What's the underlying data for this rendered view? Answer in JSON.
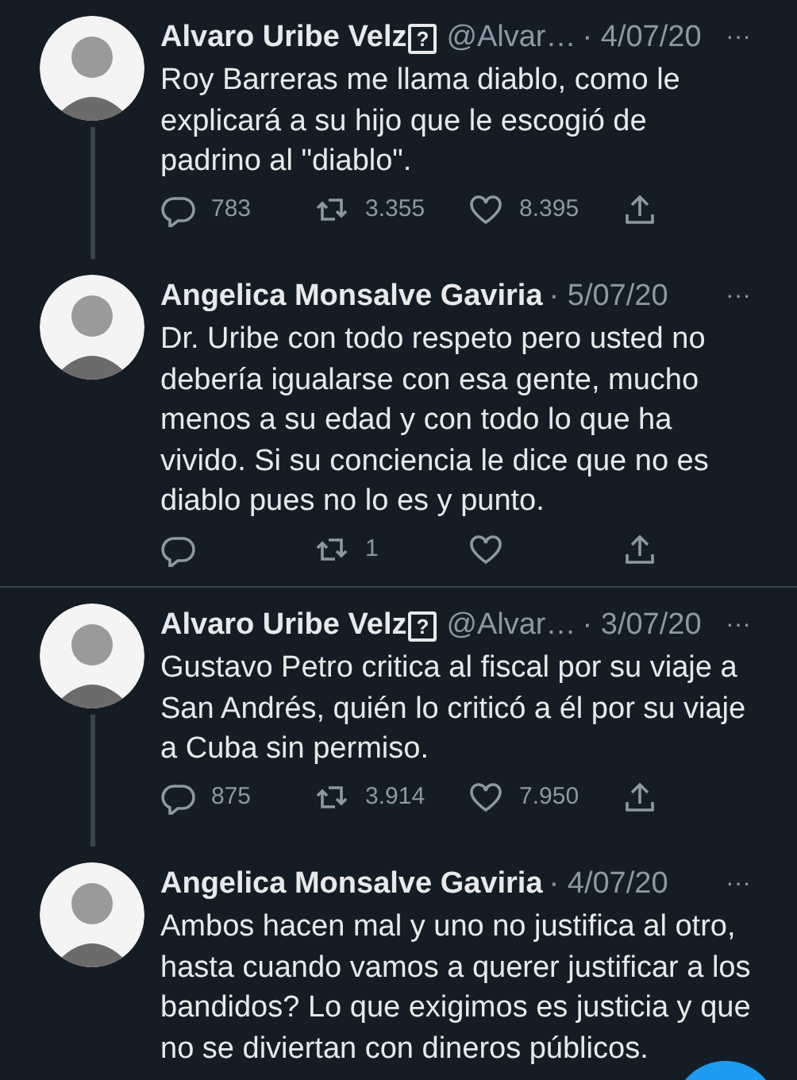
{
  "tweets": [
    {
      "author": "Alvaro Uribe Velz",
      "badge": "?",
      "handle": "@Alvar…",
      "date": "· 4/07/20",
      "more": "···",
      "text": "Roy Barreras me llama diablo, como le explicará a su hijo que le escogió de padrino al \"diablo\".",
      "thread_line": true,
      "actions": {
        "replies": "783",
        "retweets": "3.355",
        "likes": "8.395"
      },
      "divider_after": false
    },
    {
      "author": "Angelica Monsalve Gaviria",
      "date": "· 5/07/20",
      "more": "···",
      "text": "Dr. Uribe con todo respeto pero usted no debería igualarse con esa gente, mucho menos a su edad y con todo lo que ha vivido. Si su conciencia le dice que no es diablo pues no lo es y punto.",
      "thread_line": false,
      "actions": {
        "retweets": "1"
      },
      "divider_after": true
    },
    {
      "author": "Alvaro Uribe Velz",
      "badge": "?",
      "handle": "@Alvar…",
      "date": "· 3/07/20",
      "more": "···",
      "text": "Gustavo Petro critica al fiscal por su viaje a San Andrés, quién lo criticó a él por su viaje a Cuba sin permiso.",
      "thread_line": true,
      "actions": {
        "replies": "875",
        "retweets": "3.914",
        "likes": "7.950"
      },
      "divider_after": false
    },
    {
      "author": "Angelica Monsalve Gaviria",
      "date": "· 4/07/20",
      "more": "···",
      "text": "Ambos hacen mal y uno no justifica al otro, hasta cuando vamos a querer justificar a los bandidos? Lo que exigimos es justicia y que no se diviertan con dineros públicos.",
      "thread_line": false,
      "divider_after": false
    }
  ],
  "compose_button": true
}
